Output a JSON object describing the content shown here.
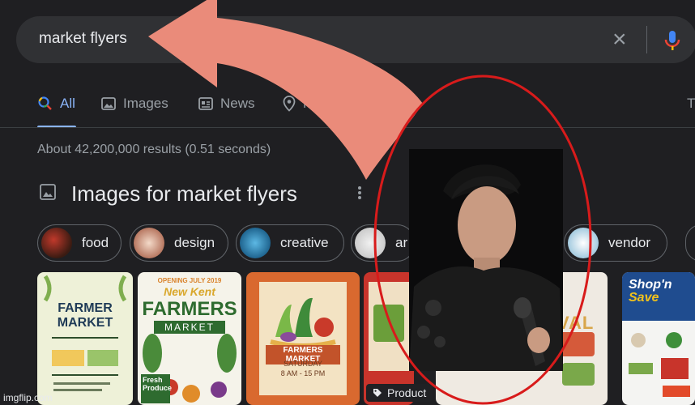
{
  "search": {
    "query": "market flyers"
  },
  "tabs": {
    "all": "All",
    "images": "Images",
    "news": "News",
    "maps": "Map",
    "more": "T"
  },
  "results": {
    "stats": "About 42,200,000 results (0.51 seconds)"
  },
  "images_section": {
    "title": "Images for market flyers",
    "chips": [
      "food",
      "design",
      "creative",
      "ar",
      "vendor"
    ]
  },
  "tiles": {
    "farmer_market": [
      "FARMER",
      "MARKET"
    ],
    "farmers_market": [
      "OPENING JULY 2019",
      "New Kent",
      "FARMERS",
      "MARKET",
      "Fresh",
      "Produce"
    ],
    "orange_flyer": [
      "FARMERS MARKET",
      "SATURDAY",
      "8 AM - 15 PM"
    ],
    "shop_n_save": [
      "Shop'n",
      "Save"
    ],
    "product_tag": "Product",
    "partial": "VAL"
  },
  "watermark": "imgflip.com",
  "colors": {
    "background": "#1f1f22",
    "accent": "#8ab4f8",
    "arrow": "#ea8b7a",
    "ellipse": "#d81b1b"
  }
}
